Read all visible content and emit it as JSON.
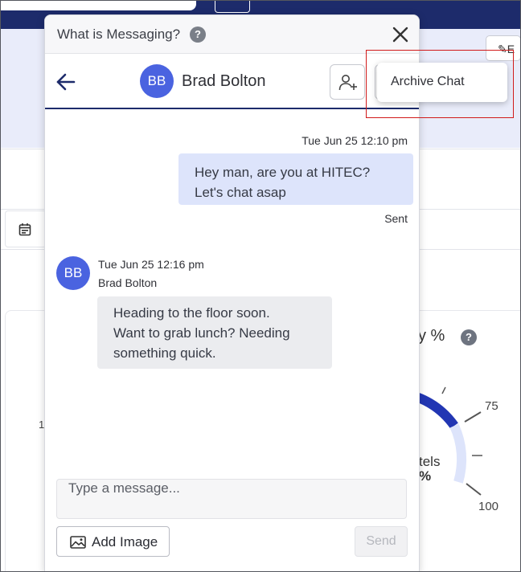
{
  "panel": {
    "title": "What is Messaging?",
    "help_icon": "question-mark-icon",
    "help_glyph": "?"
  },
  "chat": {
    "contact_name": "Brad Bolton",
    "contact_initials": "BB"
  },
  "menu": {
    "items": [
      {
        "label": "Archive Chat"
      }
    ]
  },
  "messages": [
    {
      "direction": "outgoing",
      "timestamp": "Tue Jun 25 12:10 pm",
      "lines": [
        "Hey man, are you at HITEC?",
        "Let's chat asap"
      ],
      "status": "Sent"
    },
    {
      "direction": "incoming",
      "timestamp": "Tue Jun 25 12:16 pm",
      "sender": "Brad Bolton",
      "sender_initials": "BB",
      "lines": [
        "Heading to the floor soon.",
        "Want to grab lunch? Needing",
        "something quick."
      ]
    }
  ],
  "composer": {
    "placeholder": "Type a message...",
    "add_image_label": "Add Image",
    "send_label": "Send"
  },
  "background": {
    "card_title_fragment": "y %",
    "help_glyph": "?",
    "left_tick_fragment": "1",
    "gauge_labels": [
      "75",
      "100"
    ],
    "gauge_center_fragment": "tels",
    "gauge_center_pct": "%",
    "edit_fragment": "E"
  },
  "colors": {
    "navy": "#1d2b6b",
    "avatar_blue": "#4a63e0",
    "outgoing_bubble": "#dde4fb",
    "incoming_bubble": "#ebecef",
    "highlight_red": "#d11a1a"
  }
}
